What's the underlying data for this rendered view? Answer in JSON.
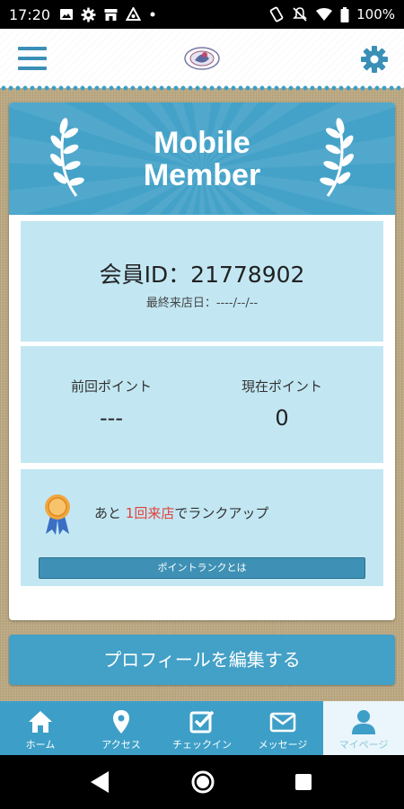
{
  "status_bar": {
    "time": "17:20",
    "battery": "100%",
    "left_icons": [
      "image-icon",
      "gear-icon",
      "store-icon",
      "share-icon",
      "dot-icon"
    ],
    "right_icons": [
      "vibrate-icon",
      "mute-icon",
      "wifi-icon",
      "battery-icon"
    ]
  },
  "header": {
    "menu_icon": "hamburger-icon",
    "logo_icon": "shop-logo-icon",
    "settings_icon": "gear-icon"
  },
  "card": {
    "title_line1": "Mobile",
    "title_line2": "Member",
    "member_id": "会員ID：21778902",
    "last_visit": "最終来店日：----/--/--",
    "previous_points_label": "前回ポイント",
    "previous_points_value": "---",
    "current_points_label": "現在ポイント",
    "current_points_value": "0",
    "rank_text_prefix": "あと ",
    "rank_text_highlight": "1回来店",
    "rank_text_suffix": "でランクアップ",
    "rank_button": "ポイントランクとは"
  },
  "profile_button": "プロフィールを編集する",
  "bottom_nav": [
    {
      "label": "ホーム",
      "icon": "home-icon",
      "active": false
    },
    {
      "label": "アクセス",
      "icon": "map-pin-icon",
      "active": false
    },
    {
      "label": "チェックイン",
      "icon": "checkin-icon",
      "active": false
    },
    {
      "label": "メッセージ",
      "icon": "mail-icon",
      "active": false
    },
    {
      "label": "マイページ",
      "icon": "user-icon",
      "active": true
    }
  ],
  "colors": {
    "primary": "#43a0c7",
    "panel": "#c2e7f3",
    "highlight": "#e2403b",
    "background": "#bca983"
  }
}
